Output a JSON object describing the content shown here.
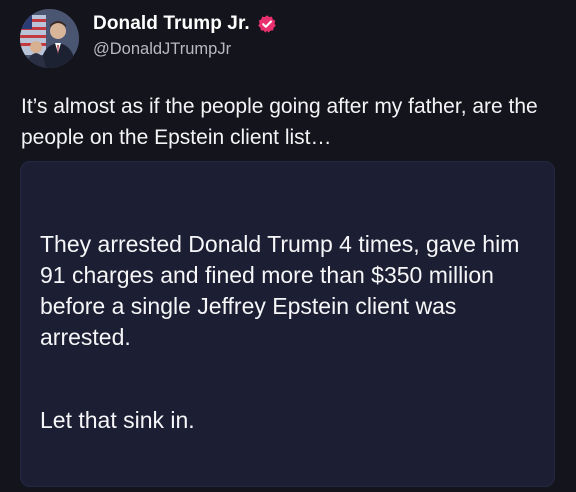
{
  "author": {
    "display_name": "Donald Trump Jr.",
    "handle": "@DonaldJTrumpJr",
    "verified_badge_color": "#e8306e",
    "avatar_icon": "profile-photo-icon",
    "verified_icon": "verified-badge-icon"
  },
  "tweet": {
    "text": "It’s almost as if the people going after my father, are the people on the Epstein client list…"
  },
  "quote": {
    "main_text": "They arrested Donald Trump 4 times, gave him 91 charges and fined more than $350 million before a single Jeffrey Epstein client was arrested.",
    "tail_text": "Let that sink in."
  },
  "colors": {
    "background": "#14141c",
    "card_background": "#1c1f33"
  }
}
